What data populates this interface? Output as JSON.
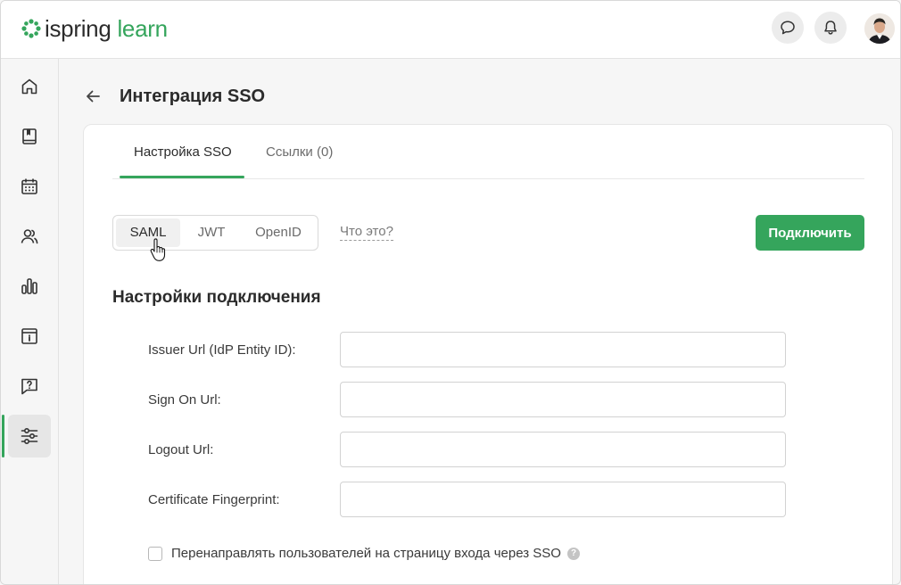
{
  "app": {
    "logo_text_part1": "ispring",
    "logo_text_part2": "learn",
    "brand_color": "#35a55c"
  },
  "header": {
    "actions": [
      {
        "icon": "chat-bubble-icon"
      },
      {
        "icon": "bell-icon"
      },
      {
        "icon": "user-avatar"
      }
    ]
  },
  "sidebar": {
    "items": [
      {
        "icon": "home-icon",
        "active": false
      },
      {
        "icon": "book-icon",
        "active": false
      },
      {
        "icon": "calendar-icon",
        "active": false
      },
      {
        "icon": "users-icon",
        "active": false
      },
      {
        "icon": "bar-chart-icon",
        "active": false
      },
      {
        "icon": "info-box-icon",
        "active": false
      },
      {
        "icon": "question-bubble-icon",
        "active": false
      },
      {
        "icon": "settings-sliders-icon",
        "active": true
      }
    ]
  },
  "page": {
    "title": "Интеграция SSO"
  },
  "tabs": [
    {
      "label": "Настройка SSO",
      "active": true
    },
    {
      "label": "Ссылки (0)",
      "active": false
    }
  ],
  "protocol_switch": {
    "options": [
      "SAML",
      "JWT",
      "OpenID"
    ],
    "selected": "SAML"
  },
  "help_link": "Что это?",
  "connect_button": "Подключить",
  "section_title": "Настройки подключения",
  "fields": [
    {
      "label": "Issuer Url (IdP Entity ID):",
      "value": ""
    },
    {
      "label": "Sign On Url:",
      "value": ""
    },
    {
      "label": "Logout Url:",
      "value": ""
    },
    {
      "label": "Certificate Fingerprint:",
      "value": ""
    }
  ],
  "redirect_option": {
    "label": "Перенаправлять пользователей на страницу входа через SSO",
    "checked": false,
    "help": "?"
  }
}
